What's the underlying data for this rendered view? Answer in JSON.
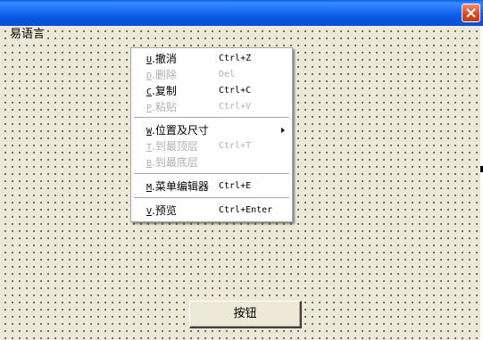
{
  "window": {
    "caption": "易语言"
  },
  "button": {
    "label": "按钮"
  },
  "menu": {
    "items": [
      {
        "accel": "U",
        "label": ".撤消",
        "shortcut": "Ctrl+Z"
      },
      {
        "accel": "D",
        "label": ".删除",
        "shortcut": "Del"
      },
      {
        "accel": "C",
        "label": ".复制",
        "shortcut": "Ctrl+C"
      },
      {
        "accel": "P",
        "label": ".粘贴",
        "shortcut": "Ctrl+V"
      },
      {
        "accel": "W",
        "label": ".位置及尺寸",
        "shortcut": ""
      },
      {
        "accel": "T",
        "label": ".到最顶层",
        "shortcut": "Ctrl+T"
      },
      {
        "accel": "B",
        "label": ".到最底层",
        "shortcut": ""
      },
      {
        "accel": "M",
        "label": ".菜单编辑器",
        "shortcut": "Ctrl+E"
      },
      {
        "accel": "V",
        "label": ".预览",
        "shortcut": "Ctrl+Enter"
      }
    ]
  }
}
